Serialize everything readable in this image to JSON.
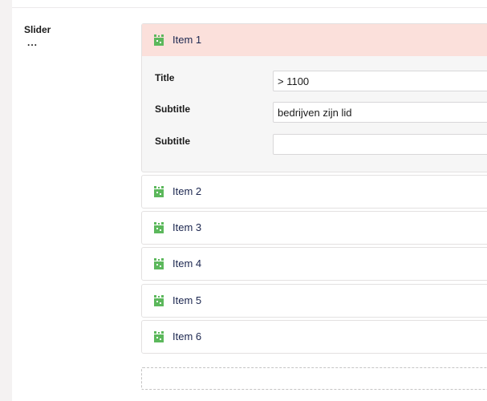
{
  "property": {
    "label": "Slider",
    "description": "..."
  },
  "blocks": [
    {
      "label": "Item 1",
      "expanded": true,
      "fields": [
        {
          "label": "Title",
          "value": "> 1100"
        },
        {
          "label": "Subtitle",
          "value": "bedrijven zijn lid"
        },
        {
          "label": "Subtitle",
          "value": ""
        }
      ]
    },
    {
      "label": "Item 2",
      "expanded": false
    },
    {
      "label": "Item 3",
      "expanded": false
    },
    {
      "label": "Item 4",
      "expanded": false
    },
    {
      "label": "Item 5",
      "expanded": false
    },
    {
      "label": "Item 6",
      "expanded": false
    }
  ],
  "icon": {
    "name": "block-element-icon",
    "color": "#5cb85c"
  },
  "colors": {
    "active_header": "#fbe0db",
    "text": "#1b264f"
  }
}
